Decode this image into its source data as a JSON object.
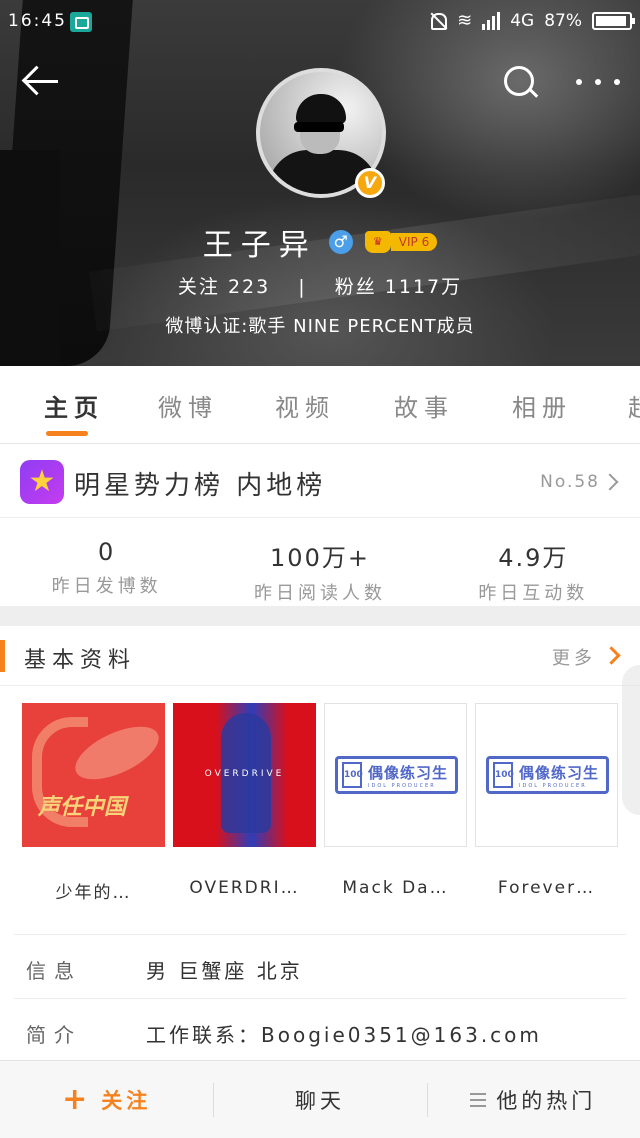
{
  "status_bar": {
    "time": "16:45",
    "network": "4G",
    "battery": "87%"
  },
  "profile": {
    "name": "王子异",
    "vip": "VIP 6",
    "following_label": "关注",
    "following_count": "223",
    "separator": "|",
    "fans_label": "粉丝",
    "fans_count": "1117万",
    "verification": "微博认证:歌手 NINE PERCENT成员"
  },
  "tabs": [
    {
      "label": "主页",
      "active": true
    },
    {
      "label": "微博"
    },
    {
      "label": "视频"
    },
    {
      "label": "故事"
    },
    {
      "label": "相册"
    },
    {
      "label": "超"
    }
  ],
  "star_rank": {
    "title": "明星势力榜 内地榜",
    "rank": "No.58"
  },
  "stats": [
    {
      "value": "0",
      "label": "昨日发博数"
    },
    {
      "value": "100万+",
      "label": "昨日阅读人数"
    },
    {
      "value": "4.9万",
      "label": "昨日互动数"
    }
  ],
  "basic_info": {
    "title": "基本资料",
    "more": "更多",
    "albums": [
      {
        "label": "少年的…",
        "cover_text": "声任中国"
      },
      {
        "label": "OVERDRI…",
        "cover_text": "OVERDRIVE"
      },
      {
        "label": "Mack Da…",
        "logo_box": "100",
        "logo_text": "偶像练习生",
        "logo_sub": "IDOL PRODUCER"
      },
      {
        "label": "Forever…",
        "logo_box": "100",
        "logo_text": "偶像练习生",
        "logo_sub": "IDOL PRODUCER"
      }
    ],
    "rows": [
      {
        "key": "信息",
        "value": "男 巨蟹座 北京"
      },
      {
        "key": "简介",
        "value": "工作联系：Boogie0351@163.com"
      }
    ]
  },
  "bottom_bar": {
    "follow": "关注",
    "chat": "聊天",
    "hot": "他的热门"
  },
  "colors": {
    "accent": "#f5821f",
    "vip_gold": "#f5b800",
    "rank_purple": "#a03cf0"
  }
}
